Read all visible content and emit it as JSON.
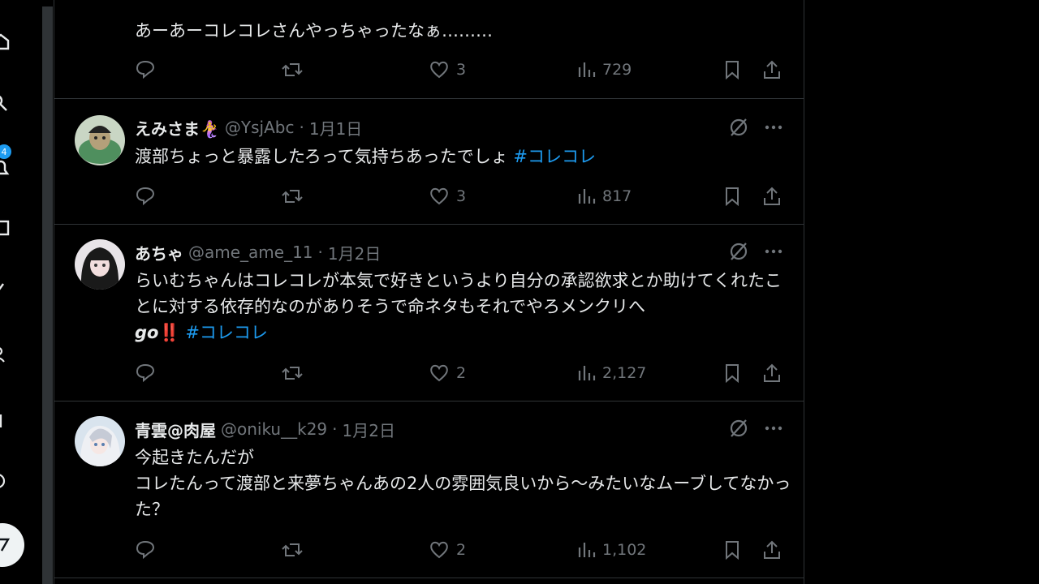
{
  "left_rail": {
    "notification_count": "4"
  },
  "tweets": [
    {
      "body": "あーあーコレコレさんやっちゃったなぁ………",
      "replies": "",
      "retweets": "",
      "likes": "3",
      "views": "729"
    },
    {
      "name": "えみさま🧜‍♀️",
      "handle": "@YsjAbc",
      "dot": "·",
      "date": "1月1日",
      "body_text": "渡部ちょっと暴露したろって気持ちあったでしょ ",
      "hashtag": "#コレコレ",
      "likes": "3",
      "views": "817"
    },
    {
      "name": "あちゃ",
      "handle": "@ame_ame_11",
      "dot": "·",
      "date": "1月2日",
      "body_text": "らいむちゃんはコレコレが本気で好きというより自分の承認欲求とか助けてくれたことに対する依存的なのがありそうで命ネタもそれでやろメンクリへ",
      "body_go": "go",
      "body_emoji": "‼️",
      "hashtag": "#コレコレ",
      "likes": "2",
      "views": "2,127"
    },
    {
      "name": "青雲@肉屋",
      "handle": "@oniku__k29",
      "dot": "·",
      "date": "1月2日",
      "body_text": "今起きたんだが\nコレたんって渡部と来夢ちゃんあの2人の雰囲気良いから〜みたいなムーブしてなかった？",
      "likes": "2",
      "views": "1,102"
    }
  ],
  "colors": {
    "background": "#000000",
    "text": "#e7e9ea",
    "muted": "#71767b",
    "accent": "#1d9bf0",
    "border": "#2f3336"
  }
}
